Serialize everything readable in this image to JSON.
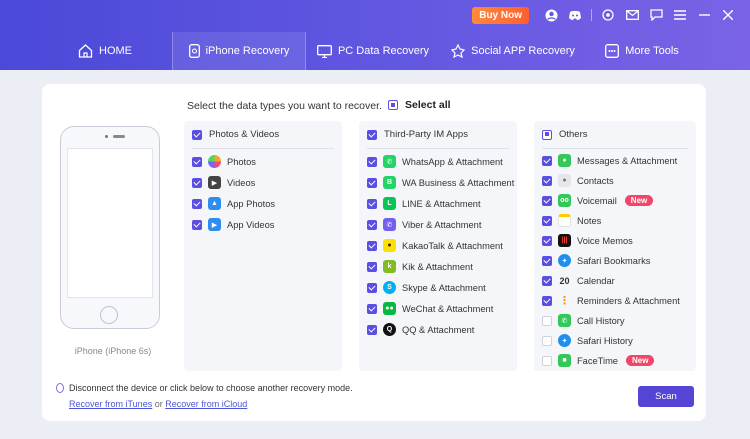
{
  "topbar": {
    "buy_label": "Buy Now"
  },
  "tabs": [
    {
      "label": "HOME",
      "icon": "home-icon"
    },
    {
      "label": "iPhone Recovery",
      "icon": "phone-icon",
      "active": true
    },
    {
      "label": "PC Data Recovery",
      "icon": "monitor-icon"
    },
    {
      "label": "Social APP Recovery",
      "icon": "apps-icon"
    },
    {
      "label": "More Tools",
      "icon": "grid-icon"
    }
  ],
  "device": {
    "label": "iPhone (iPhone 6s)"
  },
  "main": {
    "prompt": "Select the data types you want to recover.",
    "select_all": "Select all"
  },
  "columns": {
    "photos": {
      "title": "Photos & Videos",
      "items": [
        {
          "label": "Photos",
          "checked": true
        },
        {
          "label": "Videos",
          "checked": true
        },
        {
          "label": "App Photos",
          "checked": true
        },
        {
          "label": "App Videos",
          "checked": true
        }
      ]
    },
    "im": {
      "title": "Third-Party IM Apps",
      "items": [
        {
          "label": "WhatsApp & Attachment",
          "checked": true
        },
        {
          "label": "WA Business & Attachment",
          "checked": true
        },
        {
          "label": "LINE & Attachment",
          "checked": true
        },
        {
          "label": "Viber & Attachment",
          "checked": true
        },
        {
          "label": "KakaoTalk & Attachment",
          "checked": true
        },
        {
          "label": "Kik & Attachment",
          "checked": true
        },
        {
          "label": "Skype & Attachment",
          "checked": true
        },
        {
          "label": "WeChat & Attachment",
          "checked": true
        },
        {
          "label": "QQ & Attachment",
          "checked": true
        }
      ]
    },
    "others": {
      "title": "Others",
      "items": [
        {
          "label": "Messages & Attachment",
          "checked": true
        },
        {
          "label": "Contacts",
          "checked": true
        },
        {
          "label": "Voicemail",
          "checked": true,
          "badge": "New"
        },
        {
          "label": "Notes",
          "checked": true
        },
        {
          "label": "Voice Memos",
          "checked": true
        },
        {
          "label": "Safari Bookmarks",
          "checked": true
        },
        {
          "label": "Calendar",
          "checked": true,
          "icon_text": "20"
        },
        {
          "label": "Reminders & Attachment",
          "checked": true
        },
        {
          "label": "Call History",
          "checked": false
        },
        {
          "label": "Safari History",
          "checked": false
        },
        {
          "label": "FaceTime",
          "checked": false,
          "badge": "New"
        }
      ]
    }
  },
  "footer": {
    "notice": "Disconnect the device or click below to choose another recovery mode.",
    "link_itunes": "Recover from iTunes",
    "or": "or",
    "link_icloud": "Recover from iCloud",
    "scan_label": "Scan"
  }
}
